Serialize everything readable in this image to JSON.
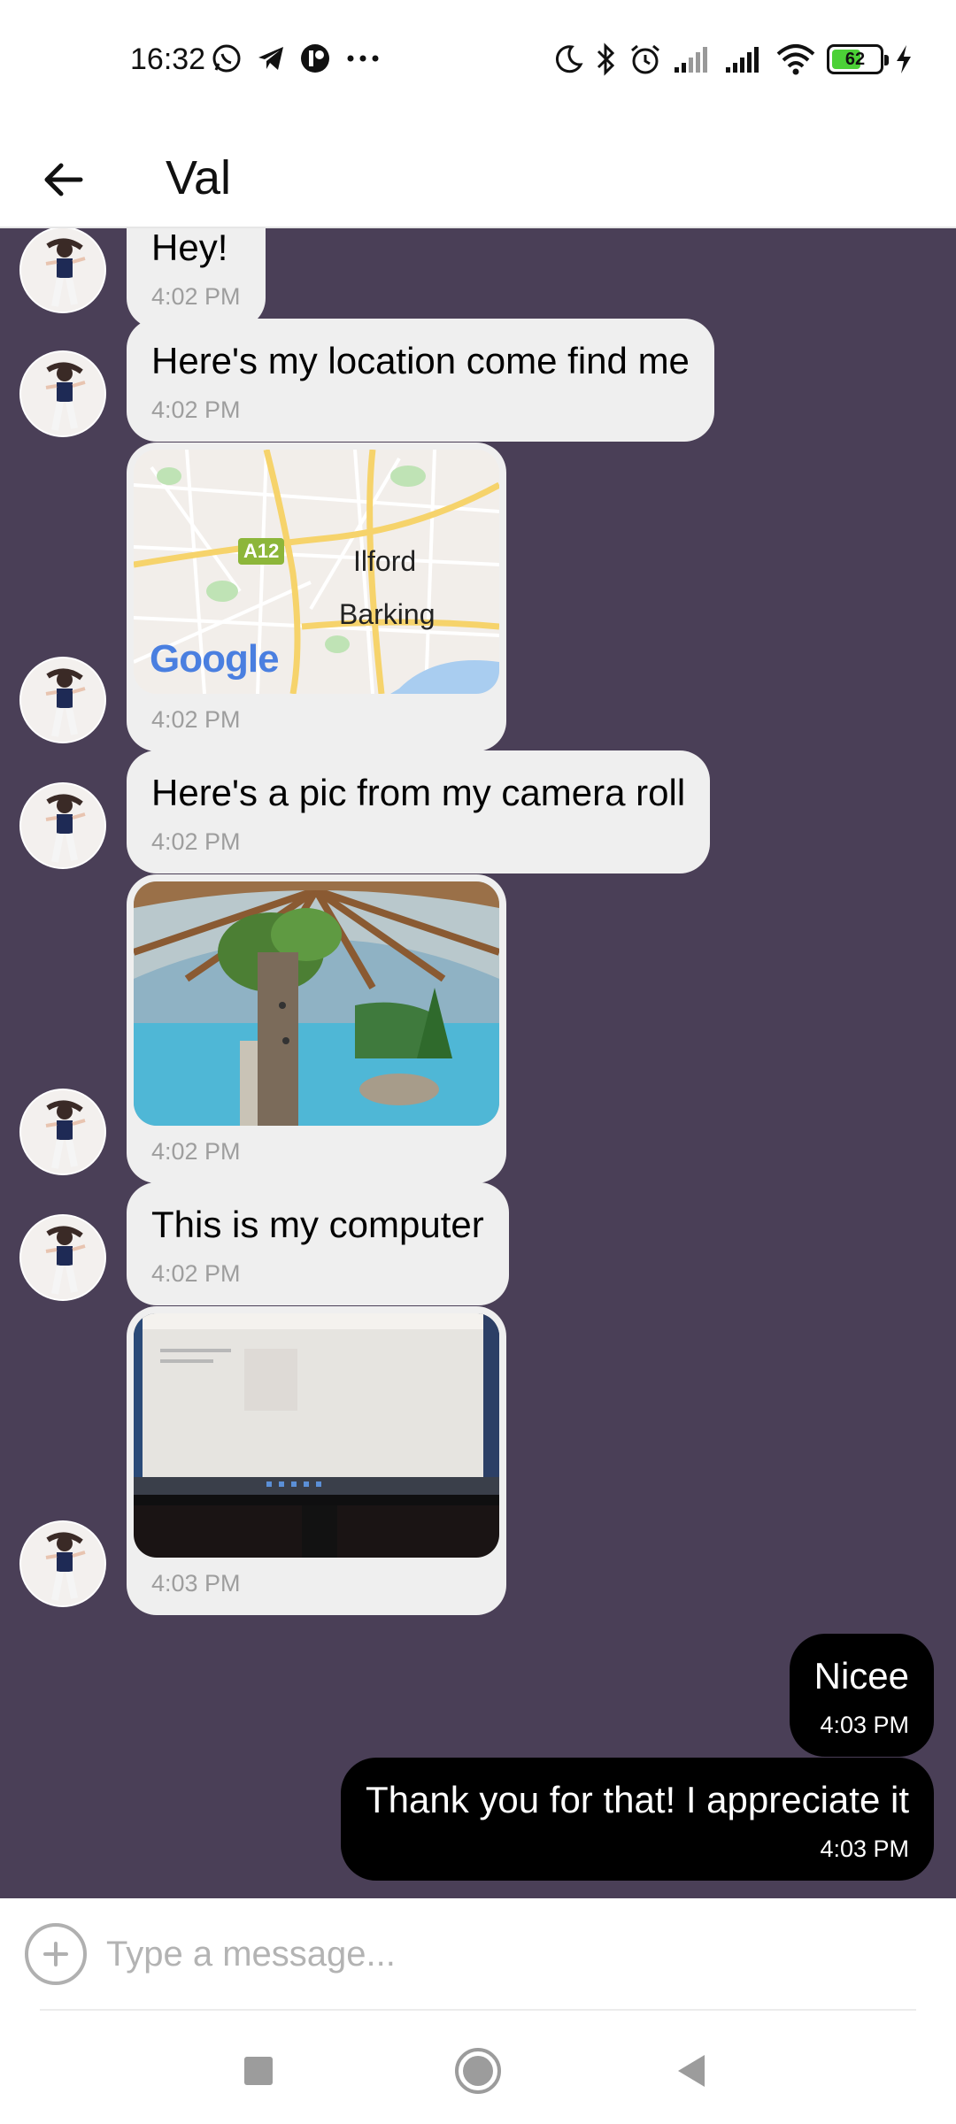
{
  "status_bar": {
    "time": "16:32",
    "battery_level": "62",
    "left_icons": [
      "whatsapp-icon",
      "telegram-icon",
      "app-icon",
      "more-dots-icon"
    ],
    "right_icons": [
      "moon-icon",
      "bluetooth-icon",
      "alarm-icon",
      "signal-icon",
      "signal-icon",
      "wifi-icon",
      "battery-icon",
      "charging-icon"
    ]
  },
  "header": {
    "title": "Val"
  },
  "messages": [
    {
      "direction": "incoming",
      "type": "text",
      "text": "Hey!",
      "time": "4:02 PM"
    },
    {
      "direction": "incoming",
      "type": "text",
      "text": "Here's my location come find me",
      "time": "4:02 PM"
    },
    {
      "direction": "incoming",
      "type": "map",
      "map_labels": [
        "A12",
        "Ilford",
        "Barking"
      ],
      "map_logo": "Google",
      "time": "4:02 PM"
    },
    {
      "direction": "incoming",
      "type": "text",
      "text": "Here's a pic from my camera roll",
      "time": "4:02 PM"
    },
    {
      "direction": "incoming",
      "type": "image",
      "time": "4:02 PM"
    },
    {
      "direction": "incoming",
      "type": "text",
      "text": "This is my computer",
      "time": "4:02 PM"
    },
    {
      "direction": "incoming",
      "type": "image",
      "time": "4:03 PM"
    },
    {
      "direction": "outgoing",
      "type": "text",
      "text": "Nicee",
      "time": "4:03 PM"
    },
    {
      "direction": "outgoing",
      "type": "text",
      "text": "Thank you for that! I appreciate it",
      "time": "4:03 PM"
    }
  ],
  "composer": {
    "placeholder": "Type a message..."
  },
  "colors": {
    "chat_background": "#4a3f57",
    "incoming_bubble": "#efefef",
    "outgoing_bubble": "#000000",
    "battery_fill": "#4cd137"
  }
}
